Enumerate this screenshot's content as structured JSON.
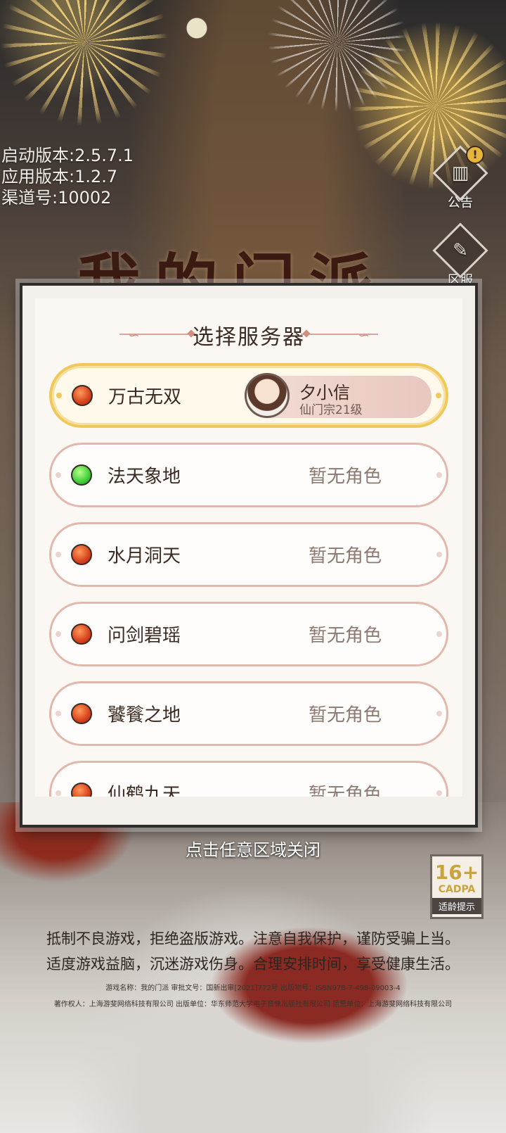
{
  "version_info": {
    "launch": "启动版本:2.5.7.1",
    "app": "应用版本:1.2.7",
    "channel": "渠道号:10002"
  },
  "side_buttons": {
    "notice_label": "公告",
    "notice_badge": "!",
    "server_label": "区服"
  },
  "game_logo": "我的门派",
  "dialog": {
    "title": "选择服务器",
    "servers": [
      {
        "name": "万古无双",
        "status": "red",
        "selected": true,
        "role": {
          "name": "夕小信",
          "level": "仙门宗21级"
        }
      },
      {
        "name": "法天象地",
        "status": "green",
        "role_text": "暂无角色"
      },
      {
        "name": "水月洞天",
        "status": "red",
        "role_text": "暂无角色"
      },
      {
        "name": "问剑碧瑶",
        "status": "red",
        "role_text": "暂无角色"
      },
      {
        "name": "饕餮之地",
        "status": "red",
        "role_text": "暂无角色"
      },
      {
        "name": "仙鹤九天",
        "status": "red",
        "role_text": "暂无角色"
      }
    ]
  },
  "close_hint": "点击任意区域关闭",
  "age_badge": {
    "rating": "16+",
    "org": "CADPA",
    "tip": "适龄提示"
  },
  "health_notice": {
    "line1": "抵制不良游戏，拒绝盗版游戏。注意自我保护，谨防受骗上当。",
    "line2": "适度游戏益脑，沉迷游戏伤身。合理安排时间，享受健康生活。"
  },
  "credits": {
    "line1": "游戏名称：我的门派 审批文号：国新出审[2021]772号 出版物号：ISBN978-7-498-09003-4",
    "line2": "著作权人：上海游斐网络科技有限公司 出版单位：华东师范大学电子音像出版社有限公司 运营单位：上海游斐网络科技有限公司"
  },
  "colors": {
    "status_red": "#d7421c",
    "status_green": "#3fcf3a",
    "selected_border": "#f0c85a",
    "row_border": "#e2b8ad"
  }
}
